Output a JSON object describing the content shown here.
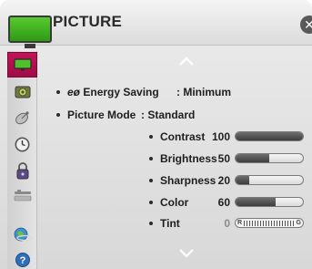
{
  "header": {
    "title": "PICTURE",
    "close_glyph": "✕",
    "tv_icon": "tv-icon"
  },
  "sidebar": {
    "items": [
      {
        "icon": "picture-tv-icon",
        "active": true
      },
      {
        "icon": "audio-speaker-icon",
        "active": false
      },
      {
        "icon": "satellite-channel-icon",
        "active": false
      },
      {
        "icon": "clock-time-icon",
        "active": false
      },
      {
        "icon": "lock-icon",
        "active": false
      },
      {
        "icon": "option-icon",
        "active": false
      },
      {
        "icon": "network-globe-icon",
        "active": false
      },
      {
        "icon": "help-question-icon",
        "active": false
      }
    ]
  },
  "settings": {
    "energy_saving": {
      "prefix": "eø",
      "label": "Energy Saving",
      "value": ": Minimum"
    },
    "picture_mode": {
      "label": "Picture Mode",
      "value": ": Standard"
    },
    "sliders": [
      {
        "label": "Contrast",
        "value": "100",
        "level": 100
      },
      {
        "label": "Brightness",
        "value": "50",
        "level": 50
      },
      {
        "label": "Sharpness",
        "value": "20",
        "level": 20
      },
      {
        "label": "Color",
        "value": "60",
        "level": 60
      }
    ],
    "tint": {
      "label": "Tint",
      "value": "0",
      "left": "R",
      "right": "G"
    }
  },
  "colors": {
    "accent": "#b0104f",
    "fill": "#4a4a4a"
  }
}
